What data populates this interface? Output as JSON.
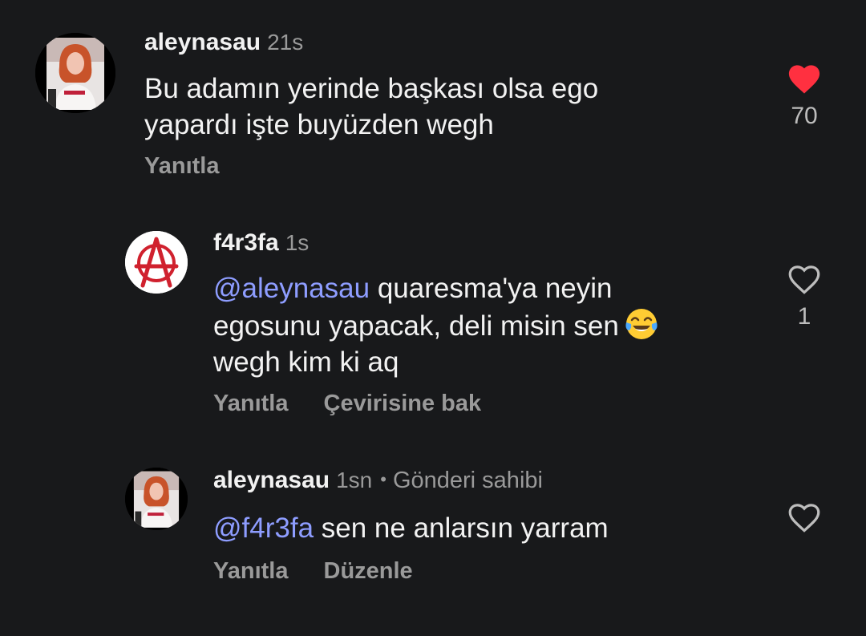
{
  "comments": [
    {
      "username": "aleynasau",
      "time": "21s",
      "text_lines": [
        "Bu adamın yerinde başkası olsa ego",
        "yapardı işte buyüzden wegh"
      ],
      "reply_label": "Yanıtla",
      "liked": true,
      "like_count": "70"
    },
    {
      "username": "f4r3fa",
      "time": "1s",
      "mention": "@aleynasau",
      "text_line1": " quaresma'ya neyin",
      "text_line2": "egosunu yapacak, deli misin sen",
      "text_line3": "wegh kim ki aq",
      "emoji": "😂",
      "reply_label": "Yanıtla",
      "translate_label": "Çevirisine bak",
      "liked": false,
      "like_count": "1"
    },
    {
      "username": "aleynasau",
      "time": "1sn",
      "separator": "•",
      "owner_label": "Gönderi sahibi",
      "mention": "@f4r3fa",
      "text": " sen ne anlarsın yarram",
      "reply_label": "Yanıtla",
      "edit_label": "Düzenle",
      "liked": false
    }
  ],
  "colors": {
    "background": "#18191b",
    "mention": "#8e9dff",
    "heart_liked": "#ff3040",
    "muted": "#9a9a9a",
    "anarchy_red": "#d0212e"
  },
  "icons": {
    "liked": "heart-filled-icon",
    "unliked": "heart-outline-icon",
    "emoji": "face-with-tears-of-joy"
  }
}
